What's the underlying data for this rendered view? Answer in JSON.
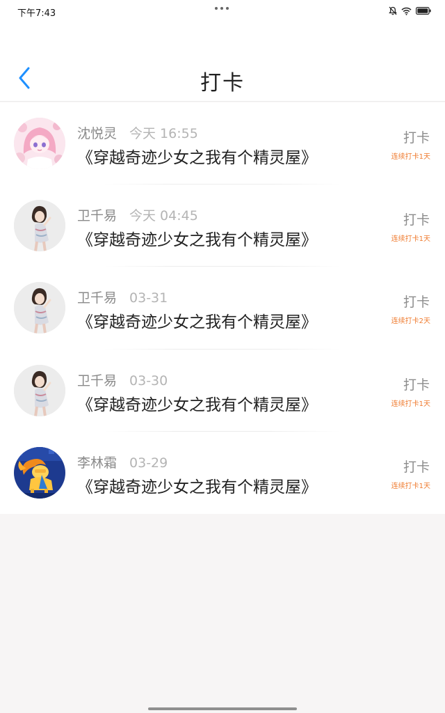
{
  "status_bar": {
    "time": "下午7:43",
    "icons": [
      "mute-bell-icon",
      "wifi-icon",
      "battery-icon"
    ]
  },
  "header": {
    "title": "打卡",
    "back_icon": "chevron-left-icon",
    "accent_color": "#1e90ff"
  },
  "list": {
    "items": [
      {
        "name": "沈悦灵",
        "time": "今天 16:55",
        "book": "《穿越奇迹少女之我有个精灵屋》",
        "checkin_label": "打卡",
        "streak": "连续打卡1天",
        "avatar": "anime-girl-avatar"
      },
      {
        "name": "卫千易",
        "time": "今天 04:45",
        "book": "《穿越奇迹少女之我有个精灵屋》",
        "checkin_label": "打卡",
        "streak": "连续打卡1天",
        "avatar": "girl-photo-avatar"
      },
      {
        "name": "卫千易",
        "time": "03-31",
        "book": "《穿越奇迹少女之我有个精灵屋》",
        "checkin_label": "打卡",
        "streak": "连续打卡2天",
        "avatar": "girl-photo-avatar"
      },
      {
        "name": "卫千易",
        "time": "03-30",
        "book": "《穿越奇迹少女之我有个精灵屋》",
        "checkin_label": "打卡",
        "streak": "连续打卡1天",
        "avatar": "girl-photo-avatar"
      },
      {
        "name": "李林霜",
        "time": "03-29",
        "book": "《穿越奇迹少女之我有个精灵屋》",
        "checkin_label": "打卡",
        "streak": "连续打卡1天",
        "avatar": "pony-avatar"
      }
    ]
  },
  "colors": {
    "streak": "#ef7b2f",
    "name": "#8a8a8a",
    "time": "#b4b4b4",
    "book": "#222222"
  }
}
